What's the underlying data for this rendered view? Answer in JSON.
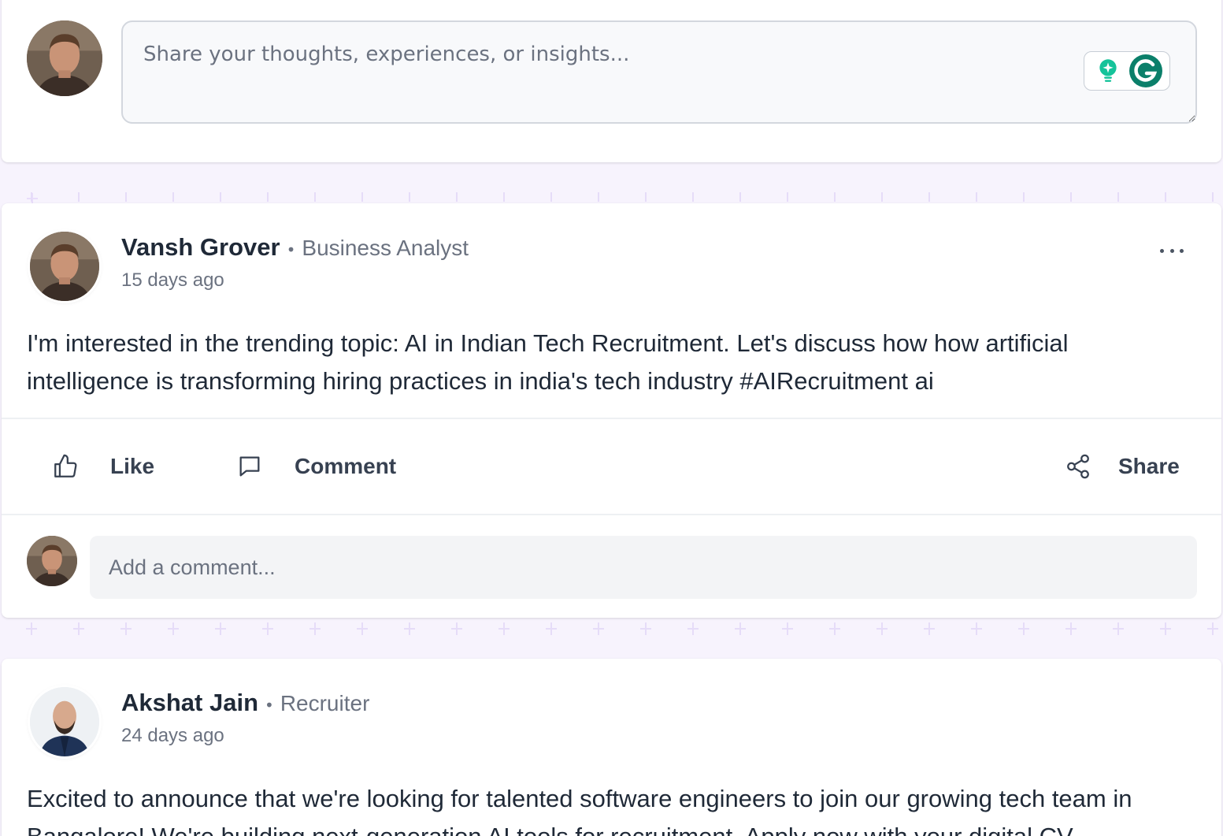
{
  "colors": {
    "page_background": "#f7f3fd",
    "card_background": "#ffffff",
    "text_primary": "#1f2937",
    "text_secondary": "#6b7280",
    "grammarly_green": "#15c39a",
    "grammarly_dark": "#0b7f6a"
  },
  "composer": {
    "placeholder": "Share your thoughts, experiences, or insights...",
    "avatar_icon": "user-avatar",
    "assist_icons": [
      "lightbulb-icon",
      "grammarly-icon"
    ]
  },
  "posts": [
    {
      "author": "Vansh Grover",
      "separator": "•",
      "role": "Business Analyst",
      "time": "15 days ago",
      "body": "I'm interested in the trending topic: AI in Indian Tech Recruitment. Let's discuss how how artificial intelligence is transforming hiring practices in india's tech industry #AIRecruitment ai",
      "actions": {
        "like": "Like",
        "comment": "Comment",
        "share": "Share"
      },
      "comment_placeholder": "Add a comment..."
    },
    {
      "author": "Akshat Jain",
      "separator": "•",
      "role": "Recruiter",
      "time": "24 days ago",
      "body": "Excited to announce that we're looking for talented software engineers to join our growing tech team in Bangalore! We're building next-generation AI tools for recruitment. Apply now with your digital CV."
    }
  ]
}
